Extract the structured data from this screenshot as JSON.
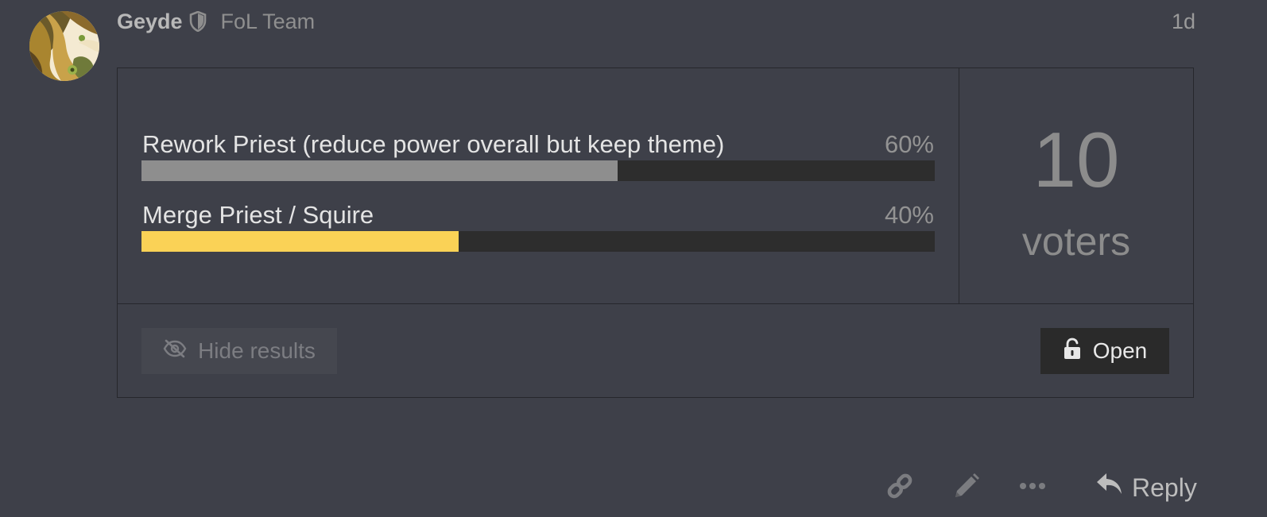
{
  "post": {
    "username": "Geyde",
    "user_title": "FoL Team",
    "date": "1d"
  },
  "poll": {
    "options": [
      {
        "label": "Rework Priest (reduce power overall but keep theme)",
        "percent_label": "60%",
        "percent": 60,
        "bar_color": "#8e8e8e"
      },
      {
        "label": "Merge Priest / Squire",
        "percent_label": "40%",
        "percent": 40,
        "bar_color": "#fad256"
      }
    ],
    "voter_count": "10",
    "voter_label": "voters",
    "hide_results_label": "Hide results",
    "status_label": "Open"
  },
  "actions": {
    "reply_label": "Reply",
    "icons": [
      "link-icon",
      "pencil-icon",
      "ellipsis-icon",
      "reply-icon"
    ]
  },
  "colors": {
    "background": "#3e4049",
    "bar_track": "#2d2d2d",
    "accent_yellow": "#fad256"
  }
}
